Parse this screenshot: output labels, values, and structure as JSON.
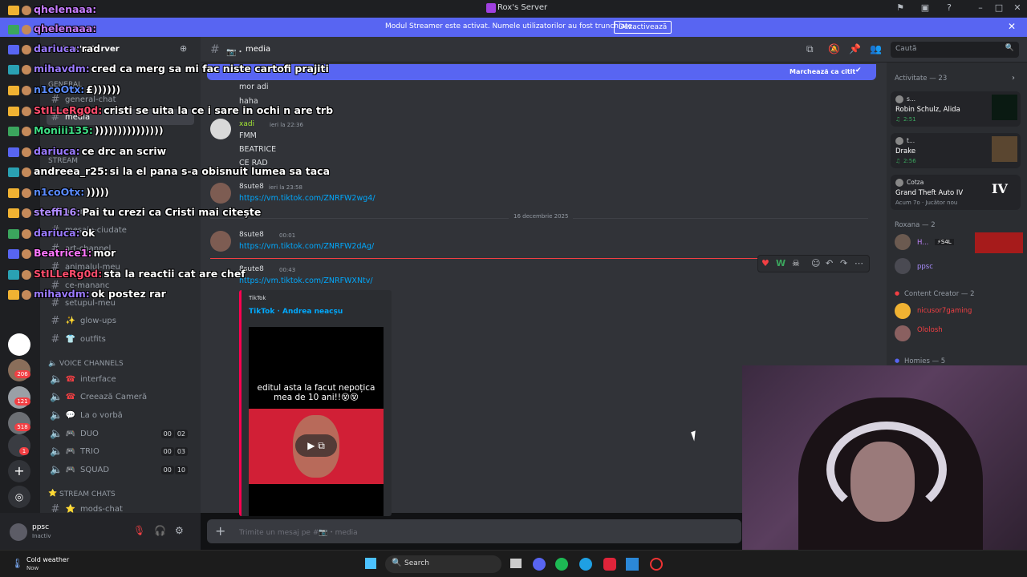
{
  "window": {
    "title": "Rox's Server"
  },
  "banner": {
    "text": "Modul Streamer este activat. Numele utilizatorilor au fost trunchiate.",
    "button": "Dezactivează"
  },
  "server": {
    "name": "Rox's Server"
  },
  "rail_badges": [
    "206",
    "121",
    "518",
    "1"
  ],
  "categories": {
    "general": "GENERAL",
    "stream": "STREAM",
    "voice": "VOICE CHANNELS",
    "stream_chats": "STREAM CHATS"
  },
  "channels": [
    {
      "name": "general-chat",
      "emoji": ""
    },
    {
      "name": "media",
      "emoji": ""
    },
    {
      "name": "anunturi",
      "emoji": ""
    },
    {
      "name": "mesaje-ciudate",
      "emoji": ""
    },
    {
      "name": "art-channel",
      "emoji": ""
    },
    {
      "name": "animalul-meu",
      "emoji": ""
    },
    {
      "name": "ce-mananc",
      "emoji": ""
    },
    {
      "name": "setupul-meu",
      "emoji": ""
    },
    {
      "name": "glow-ups",
      "emoji": "✨"
    },
    {
      "name": "outfits",
      "emoji": "👕"
    }
  ],
  "voice_channels": [
    {
      "name": "interface",
      "counts": []
    },
    {
      "name": "Creează Cameră",
      "counts": []
    },
    {
      "name": "La o vorbă",
      "counts": []
    },
    {
      "name": "DUO",
      "counts": [
        "00",
        "02"
      ]
    },
    {
      "name": "TRIO",
      "counts": [
        "00",
        "03"
      ]
    },
    {
      "name": "SQUAD",
      "counts": [
        "00",
        "10"
      ]
    }
  ],
  "stream_chat_channels": [
    {
      "name": "mods-chat"
    }
  ],
  "user_panel": {
    "name": "ppsc",
    "status": "Inactiv"
  },
  "header": {
    "channel": "media",
    "search_placeholder": "Caută"
  },
  "unread_bar": {
    "label": "Marchează ca citit"
  },
  "messages": [
    {
      "lines": [
        "mor adi",
        "haha"
      ]
    },
    {
      "author": "xadi",
      "time": "ieri la 22:36",
      "lines": [
        "FMM",
        "BEATRICE",
        "CE RAD"
      ]
    },
    {
      "author": "8sute8",
      "time": "ieri la 23:58",
      "link": "https://vm.tiktok.com/ZNRFW2wg4/"
    },
    {
      "author": "8sute8",
      "time": "00:01",
      "link": "https://vm.tiktok.com/ZNRFW2dAg/"
    },
    {
      "author": "8sute8",
      "time": "00:43",
      "link": "https://vm.tiktok.com/ZNRFWXNtv/"
    }
  ],
  "date_divider": "16 decembrie 2025",
  "embed": {
    "provider": "TikTok",
    "title": "TikTok · Andrea neacșu",
    "caption": "editul asta la facut nepoțica mea de 10 ani!!😵😵"
  },
  "composer": {
    "placeholder": "Trimite un mesaj pe #📷・media"
  },
  "activity": {
    "title": "Activitate — 23",
    "cards": [
      {
        "user": "s...",
        "title": "Robin Schulz, Alida",
        "sub": "2:51"
      },
      {
        "user": "t...",
        "title": "Drake",
        "sub": "2:56"
      },
      {
        "user": "Cotza",
        "title": "Grand Theft Auto IV",
        "sub": "Acum 7o  ·  Jucător nou"
      }
    ]
  },
  "member_groups": [
    {
      "label": "Roxana — 2",
      "members": [
        "H...",
        "ppsc"
      ]
    },
    {
      "label": "Content Creator — 2",
      "members": [
        "nicusor7gaming",
        "Ololosh"
      ]
    },
    {
      "label": "Homies — 5",
      "members": []
    }
  ],
  "member_tag": "⚡S4L",
  "overlay_chat": [
    {
      "user": "qhelenaaa:",
      "text": "",
      "color": "#c77dff"
    },
    {
      "user": "qhelenaaa:",
      "text": "",
      "color": "#c77dff"
    },
    {
      "user": "dariuca:",
      "text": "rad",
      "color": "#9b7bff"
    },
    {
      "user": "mihavdm:",
      "text": "cred ca merg sa mi fac niste cartofi prajiti",
      "color": "#9b7bff"
    },
    {
      "user": "n1coOtx:",
      "text": "£))))))",
      "color": "#5b8cff"
    },
    {
      "user": "StILLeRg0d:",
      "text": "cristi se uita la ce i sare in ochi n are trb",
      "color": "#ff4d6d"
    },
    {
      "user": "Moniii135:",
      "text": ")))))))))))))))",
      "color": "#3ddc84"
    },
    {
      "user": "dariuca:",
      "text": "ce drc an scriw",
      "color": "#9b7bff"
    },
    {
      "user": "andreea_r25:",
      "text": "si la el pana s-a obisnuit lumea sa taca",
      "color": "#ffffff"
    },
    {
      "user": "n1coOtx:",
      "text": ")))))",
      "color": "#5b8cff"
    },
    {
      "user": "steffi16:",
      "text": "Pai tu crezi ca Cristi mai citește",
      "color": "#b18cff"
    },
    {
      "user": "dariuca:",
      "text": "ok",
      "color": "#9b7bff"
    },
    {
      "user": "Beatrice1:",
      "text": "mor",
      "color": "#ff77ff"
    },
    {
      "user": "StILLeRg0d:",
      "text": "sta la reactii cat are chef",
      "color": "#ff4d6d"
    },
    {
      "user": "mihavdm:",
      "text": "ok postez rar",
      "color": "#9b7bff"
    }
  ],
  "taskbar": {
    "weather_title": "Cold weather",
    "weather_sub": "Now",
    "search": "Search"
  },
  "colors": {
    "blurple": "#5865f2",
    "link": "#00a8fc",
    "bg": "#313338"
  }
}
